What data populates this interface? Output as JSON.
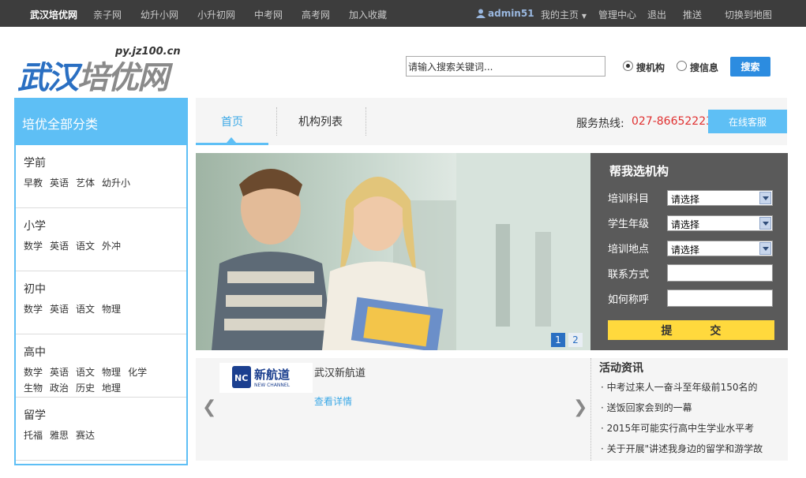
{
  "topbar": {
    "site_name": "武汉培优网",
    "links": [
      "亲子网",
      "幼升小网",
      "小升初网",
      "中考网",
      "高考网",
      "加入收藏"
    ],
    "username": "admin51",
    "my_home": "我的主页",
    "admin_center": "管理中心",
    "logout": "退出",
    "promote": "推送",
    "switch_map": "切换到地图"
  },
  "header": {
    "logo_url": "py.jz100.cn",
    "logo_part1": "武汉",
    "logo_part2": "培优网",
    "search_placeholder": "请输入搜索关键词...",
    "search_value": "请输入搜索关键词...",
    "radio_org": "搜机构",
    "radio_info": "搜信息",
    "search_button": "搜索"
  },
  "sidebar": {
    "title": "培优全部分类",
    "categories": [
      {
        "title": "学前",
        "links": [
          "早教",
          "英语",
          "艺体",
          "幼升小"
        ]
      },
      {
        "title": "小学",
        "links": [
          "数学",
          "英语",
          "语文",
          "外冲"
        ]
      },
      {
        "title": "初中",
        "links": [
          "数学",
          "英语",
          "语文",
          "物理"
        ]
      },
      {
        "title": "高中",
        "links": [
          "数学",
          "英语",
          "语文",
          "物理",
          "化学",
          "生物",
          "政治",
          "历史",
          "地理"
        ]
      },
      {
        "title": "留学",
        "links": [
          "托福",
          "雅思",
          "赛达"
        ]
      }
    ]
  },
  "tabs": {
    "home": "首页",
    "org_list": "机构列表",
    "hotline_label": "服务热线:",
    "hotline_number": "027-86652223",
    "service_button": "在线客服"
  },
  "banner": {
    "dots": [
      "1",
      "2"
    ],
    "active_dot": 0
  },
  "form": {
    "title": "帮我选机构",
    "subject_label": "培训科目",
    "grade_label": "学生年级",
    "location_label": "培训地点",
    "contact_label": "联系方式",
    "name_label": "如何称呼",
    "select_default": "请选择",
    "submit": "提 交"
  },
  "carousel": {
    "institution_name": "武汉新航道",
    "detail_link": "查看详情",
    "logo_text_cn": "新航道",
    "logo_text_en": "NEW CHANNEL",
    "prev": "❮",
    "next": "❯"
  },
  "news": {
    "title": "活动资讯",
    "items": [
      "中考过来人一奋斗至年级前150名的",
      "送饭回家会到的一幕",
      "2015年可能实行高中生学业水平考",
      "关于开展\"讲述我身边的留学和游学故"
    ]
  },
  "colors": {
    "accent": "#5ebff5",
    "dark_bar": "#3d3d3d",
    "form_bg": "#5a5a5a",
    "submit": "#ffd93d",
    "hotline": "#e03030"
  }
}
